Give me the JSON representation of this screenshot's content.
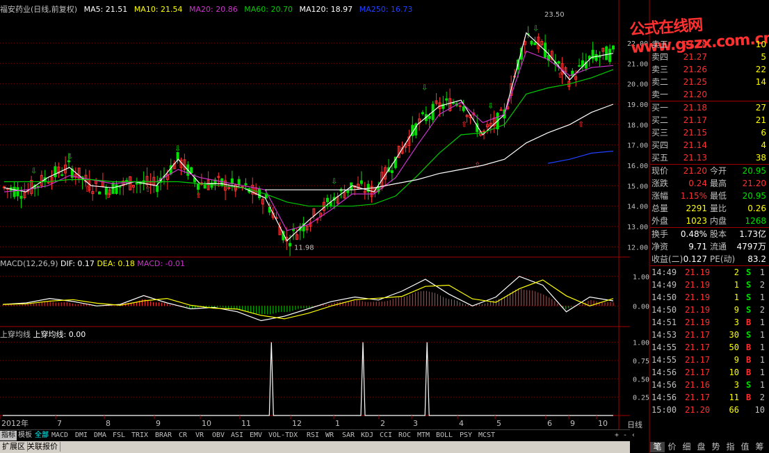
{
  "colors": {
    "up": "#ff3030",
    "down": "#00e000",
    "ma5": "#ffffff",
    "ma10": "#ffff00",
    "ma20": "#cc33cc",
    "ma60": "#00cc00",
    "ma120": "#ffffff",
    "ma250": "#2040ff",
    "grid": "#800000",
    "axis": "#a00000"
  },
  "main_legend": {
    "stock": "福安药业(日线,前复权)",
    "ma5": "MA5: 21.51",
    "ma10": "MA10: 21.54",
    "ma20": "MA20: 20.86",
    "ma60": "MA60: 20.70",
    "ma120": "MA120: 18.97",
    "ma250": "MA250: 16.73"
  },
  "main_price_labels": {
    "high": "23.50",
    "low": "11.98"
  },
  "macd_legend": {
    "name": "MACD(12,26,9)",
    "dif": "DIF: 0.17",
    "dea": "DEA: 0.18",
    "macd": "MACD: -0.01"
  },
  "signal_legend": {
    "name": "上穿均线",
    "value": "上穿均线: 0.00"
  },
  "watermark": "公式在线网www.gszx.com.cn",
  "y_axis_main": [
    "22.00",
    "21.00",
    "20.00",
    "19.00",
    "18.00",
    "17.00",
    "16.00",
    "15.00",
    "14.00",
    "13.00",
    "12.00"
  ],
  "y_axis_macd": [
    "1.00",
    "0.00"
  ],
  "y_axis_signal": [
    "1.00",
    "0.75",
    "0.50",
    "0.25"
  ],
  "x_axis": [
    "2012年",
    "7",
    "8",
    "9",
    "10",
    "11",
    "12",
    "1",
    "2",
    "3",
    "4",
    "5",
    "6",
    "9",
    "10"
  ],
  "period_label": "日线",
  "indicator_tabs": [
    "指标",
    "模板",
    "全部",
    "MACD",
    "DMI",
    "DMA",
    "FSL",
    "TRIX",
    "BRAR",
    "CR",
    "VR",
    "OBV",
    "ASI",
    "EMV",
    "VOL-TDX",
    "RSI",
    "WR",
    "SAR",
    "KDJ",
    "CCI",
    "ROC",
    "MTM",
    "BOLL",
    "PSY",
    "MCST"
  ],
  "tab_controls": [
    "+",
    "-",
    "‹"
  ],
  "bottom_tabs": [
    "扩展区",
    "关联报价"
  ],
  "order_book": {
    "asks": [
      {
        "label": "卖五",
        "price": "21.28",
        "vol": "10"
      },
      {
        "label": "卖四",
        "price": "21.27",
        "vol": "5"
      },
      {
        "label": "卖三",
        "price": "21.26",
        "vol": "22"
      },
      {
        "label": "卖二",
        "price": "21.25",
        "vol": "14"
      },
      {
        "label": "卖一",
        "price": "21.20",
        "vol": ""
      }
    ],
    "bids": [
      {
        "label": "买一",
        "price": "21.18",
        "vol": "27"
      },
      {
        "label": "买二",
        "price": "21.17",
        "vol": "21"
      },
      {
        "label": "买三",
        "price": "21.15",
        "vol": "6"
      },
      {
        "label": "买四",
        "price": "21.14",
        "vol": "4"
      },
      {
        "label": "买五",
        "price": "21.13",
        "vol": "38"
      }
    ]
  },
  "stats": [
    {
      "l1": "现价",
      "v1": "21.20",
      "l2": "今开",
      "v2": "20.95"
    },
    {
      "l1": "涨跌",
      "v1": "0.24",
      "l2": "最高",
      "v2": "21.20"
    },
    {
      "l1": "涨幅",
      "v1": "1.15%",
      "l2": "最低",
      "v2": "20.95"
    },
    {
      "l1": "总量",
      "v1": "2291",
      "l2": "量比",
      "v2": "0.26"
    },
    {
      "l1": "外盘",
      "v1": "1023",
      "l2": "内盘",
      "v2": "1268"
    }
  ],
  "stats2": [
    {
      "l1": "换手",
      "v1": "0.48%",
      "l2": "股本",
      "v2": "1.73亿"
    },
    {
      "l1": "净资",
      "v1": "9.71",
      "l2": "流通",
      "v2": "4797万"
    },
    {
      "l1": "收益(二)",
      "v1": "0.127",
      "l2": "PE(动)",
      "v2": "83.2"
    }
  ],
  "ticks": [
    {
      "time": "14:49",
      "price": "21.19",
      "vol": "2",
      "dir": "S",
      "n": "1"
    },
    {
      "time": "14:49",
      "price": "21.19",
      "vol": "1",
      "dir": "S",
      "n": "2"
    },
    {
      "time": "14:50",
      "price": "21.19",
      "vol": "1",
      "dir": "S",
      "n": "1"
    },
    {
      "time": "14:50",
      "price": "21.19",
      "vol": "9",
      "dir": "S",
      "n": "2"
    },
    {
      "time": "14:51",
      "price": "21.19",
      "vol": "3",
      "dir": "B",
      "n": "1"
    },
    {
      "time": "14:53",
      "price": "21.17",
      "vol": "30",
      "dir": "S",
      "n": "1"
    },
    {
      "time": "14:55",
      "price": "21.17",
      "vol": "50",
      "dir": "B",
      "n": "1"
    },
    {
      "time": "14:55",
      "price": "21.17",
      "vol": "9",
      "dir": "B",
      "n": "1"
    },
    {
      "time": "14:56",
      "price": "21.17",
      "vol": "10",
      "dir": "B",
      "n": "1"
    },
    {
      "time": "14:56",
      "price": "21.16",
      "vol": "3",
      "dir": "S",
      "n": "1"
    },
    {
      "time": "14:56",
      "price": "21.17",
      "vol": "11",
      "dir": "B",
      "n": "2"
    },
    {
      "time": "15:00",
      "price": "21.20",
      "vol": "66",
      "dir": "",
      "n": "10"
    }
  ],
  "right_tabs": [
    "笔",
    "价",
    "细",
    "盘",
    "势",
    "指",
    "值",
    "筹"
  ],
  "chart_data": {
    "type": "line",
    "y_range_main": [
      11.5,
      23.5
    ],
    "series": [
      {
        "name": "MA5",
        "values": [
          14.9,
          14.7,
          15.4,
          15.9,
          15.0,
          14.9,
          15.2,
          15.0,
          16.3,
          15.1,
          15.1,
          14.9,
          14.4,
          12.3,
          13.3,
          14.2,
          15.0,
          14.7,
          16.3,
          18.0,
          18.9,
          19.2,
          17.5,
          18.5,
          22.5,
          21.5,
          20.2,
          21.3,
          21.5
        ]
      },
      {
        "name": "MA20",
        "values": [
          14.7,
          14.8,
          15.0,
          15.5,
          15.3,
          15.1,
          15.2,
          15.2,
          15.8,
          15.4,
          15.2,
          15.0,
          14.8,
          12.8,
          13.1,
          13.8,
          14.6,
          14.6,
          15.4,
          17.0,
          18.5,
          19.1,
          18.1,
          18.5,
          21.6,
          21.2,
          20.4,
          20.8,
          20.9
        ]
      },
      {
        "name": "MA60",
        "values": [
          15.2,
          15.2,
          15.2,
          15.3,
          15.3,
          15.2,
          15.2,
          15.2,
          15.2,
          15.1,
          15.0,
          14.9,
          14.6,
          14.2,
          14.0,
          14.0,
          14.0,
          14.1,
          14.5,
          15.5,
          16.6,
          17.5,
          17.6,
          18.0,
          19.5,
          19.8,
          20.0,
          20.3,
          20.7
        ]
      },
      {
        "name": "MA120",
        "values": [
          null,
          null,
          null,
          null,
          null,
          null,
          null,
          null,
          null,
          null,
          null,
          null,
          14.8,
          14.8,
          14.8,
          14.8,
          14.8,
          14.9,
          15.1,
          15.3,
          15.6,
          15.8,
          16.0,
          16.3,
          17.1,
          17.6,
          18.0,
          18.6,
          19.0
        ]
      },
      {
        "name": "MA250",
        "values": [
          null,
          null,
          null,
          null,
          null,
          null,
          null,
          null,
          null,
          null,
          null,
          null,
          null,
          null,
          null,
          null,
          null,
          null,
          null,
          null,
          null,
          null,
          null,
          null,
          null,
          16.1,
          16.3,
          16.6,
          16.7
        ]
      }
    ],
    "macd": {
      "dif": [
        0.05,
        0.1,
        0.25,
        0.15,
        0.0,
        0.05,
        0.35,
        0.1,
        -0.1,
        -0.05,
        -0.2,
        -0.5,
        -0.35,
        -0.1,
        0.15,
        0.3,
        0.2,
        0.5,
        0.9,
        0.4,
        0.0,
        0.3,
        1.0,
        0.7,
        -0.2,
        0.3,
        0.17
      ],
      "ylim": [
        -0.7,
        1.3
      ]
    },
    "signal": {
      "spikes_at": [
        0.44,
        0.59,
        0.695
      ],
      "value": 1.0,
      "ylim": [
        0,
        1.1
      ]
    }
  }
}
